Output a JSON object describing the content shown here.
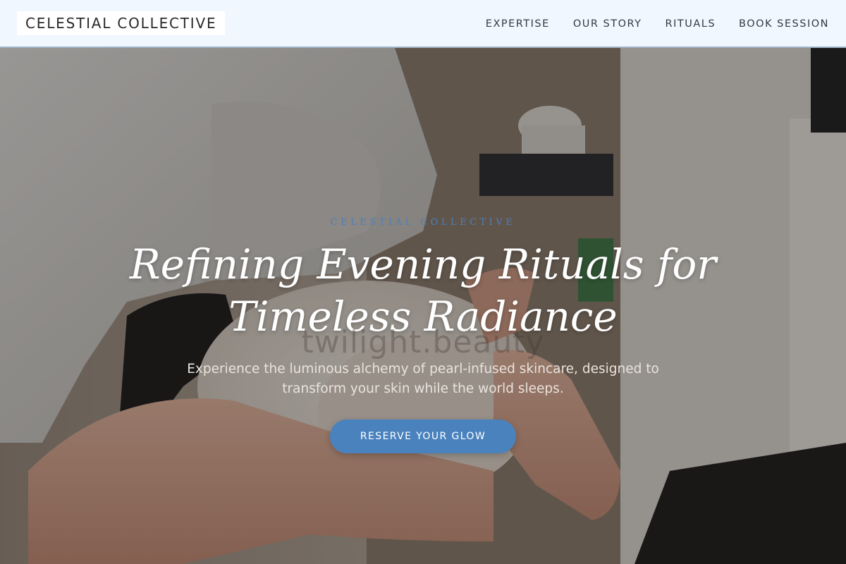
{
  "header": {
    "brand": "CELESTIAL COLLECTIVE",
    "nav": [
      {
        "label": "EXPERTISE"
      },
      {
        "label": "OUR STORY"
      },
      {
        "label": "RITUALS"
      },
      {
        "label": "BOOK SESSION"
      }
    ]
  },
  "hero": {
    "eyebrow": "CELESTIAL COLLECTIVE",
    "headline": "Refining Evening Rituals for Timeless Radiance",
    "watermark": "twilight.beauty",
    "subtext": "Experience the luminous alchemy of pearl-infused skincare, designed to transform your skin while the world sleeps.",
    "cta_label": "RESERVE YOUR GLOW",
    "background_description_icon": "facial-treatment-photo"
  },
  "colors": {
    "header_bg": "#f1f7ff",
    "accent": "#4a82be",
    "eyebrow": "#4d7fb8",
    "headline": "#ffffff"
  }
}
